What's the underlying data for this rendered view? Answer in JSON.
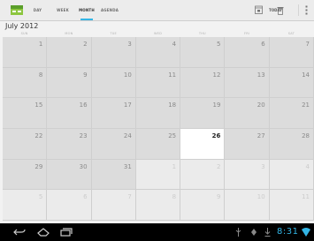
{
  "actionbar": {
    "tabs": [
      {
        "label": "DAY",
        "active": false
      },
      {
        "label": "WEEK",
        "active": false
      },
      {
        "label": "MONTH",
        "active": true
      },
      {
        "label": "AGENDA",
        "active": false
      }
    ],
    "today_label": "TODAY"
  },
  "month": {
    "title": "July 2012",
    "weekdays": [
      "SUN",
      "MON",
      "TUE",
      "WED",
      "THU",
      "FRI",
      "SAT"
    ],
    "today": "26",
    "weeks": [
      [
        "1",
        "2",
        "3",
        "4",
        "5",
        "6",
        "7"
      ],
      [
        "8",
        "9",
        "10",
        "11",
        "12",
        "13",
        "14"
      ],
      [
        "15",
        "16",
        "17",
        "18",
        "19",
        "20",
        "21"
      ],
      [
        "22",
        "23",
        "24",
        "25",
        "26",
        "27",
        "28"
      ],
      [
        "29",
        "30",
        "31",
        "1",
        "2",
        "3",
        "4"
      ],
      [
        "5",
        "6",
        "7",
        "8",
        "9",
        "10",
        "11"
      ]
    ],
    "in_month_count": 31
  },
  "systembar": {
    "clock": "8:31"
  },
  "colors": {
    "accent": "#33b5e5",
    "cell_in_month": "#dcdcdc",
    "cell_other_month": "#ebebeb",
    "cell_today": "#ffffff"
  }
}
